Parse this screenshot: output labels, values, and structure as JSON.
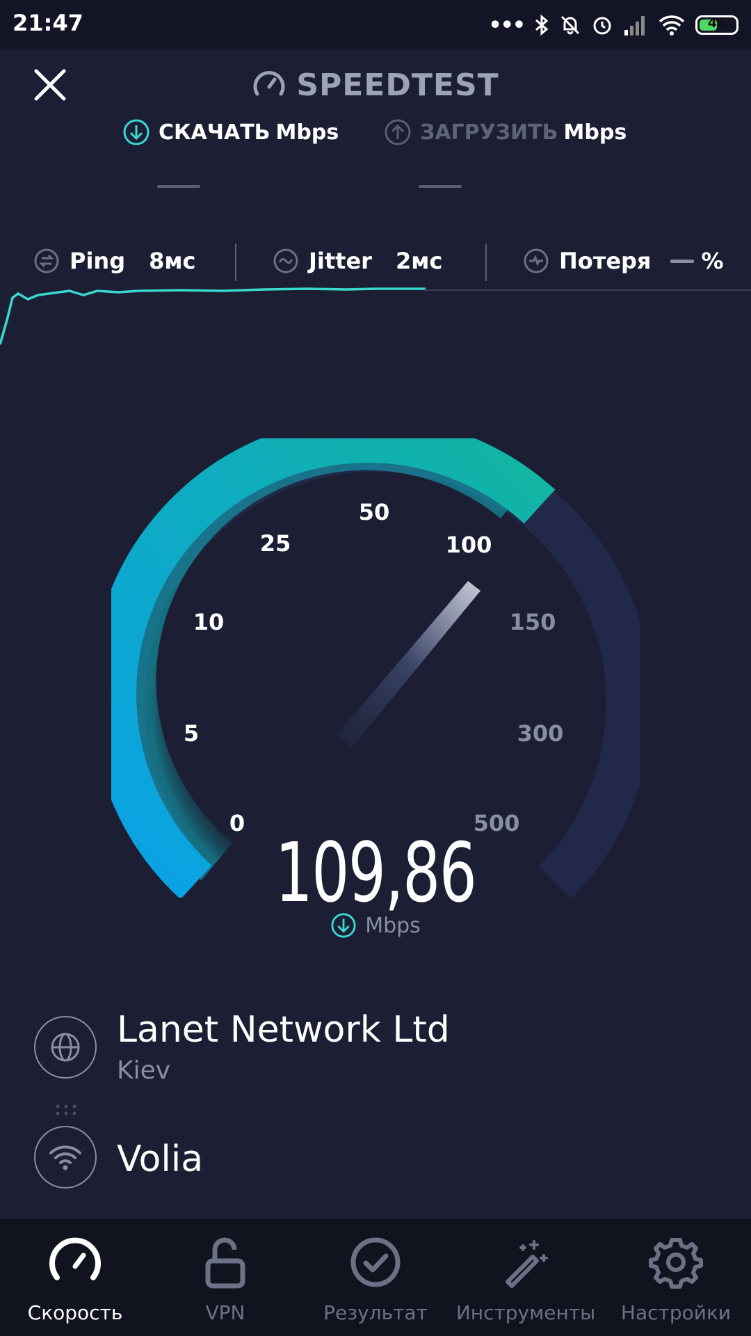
{
  "status_bar": {
    "time": "21:47",
    "battery": "46"
  },
  "header": {
    "title": "SPEEDTEST"
  },
  "tabs": {
    "download": {
      "label": "СКАЧАТЬ",
      "unit": "Mbps"
    },
    "upload": {
      "label": "ЗАГРУЗИТЬ",
      "unit": "Mbps"
    }
  },
  "metrics": {
    "ping": {
      "label": "Ping",
      "value": "8мс"
    },
    "jitter": {
      "label": "Jitter",
      "value": "2мс"
    },
    "loss": {
      "label": "Потеря",
      "unit": "%"
    }
  },
  "gauge": {
    "scale": [
      "0",
      "5",
      "10",
      "25",
      "50",
      "100",
      "150",
      "300",
      "500"
    ],
    "value": "109,86",
    "unit": "Mbps"
  },
  "server": {
    "name": "Lanet Network Ltd",
    "city": "Kiev",
    "isp": "Volia"
  },
  "nav": [
    {
      "label": "Скорость",
      "active": true
    },
    {
      "label": "VPN"
    },
    {
      "label": "Результат"
    },
    {
      "label": "Инструменты"
    },
    {
      "label": "Настройки"
    }
  ],
  "colors": {
    "background": "#1c1f33",
    "accent": "#39d9d0",
    "gauge_start": "#0aa1e8",
    "gauge_end": "#12b5a0"
  }
}
